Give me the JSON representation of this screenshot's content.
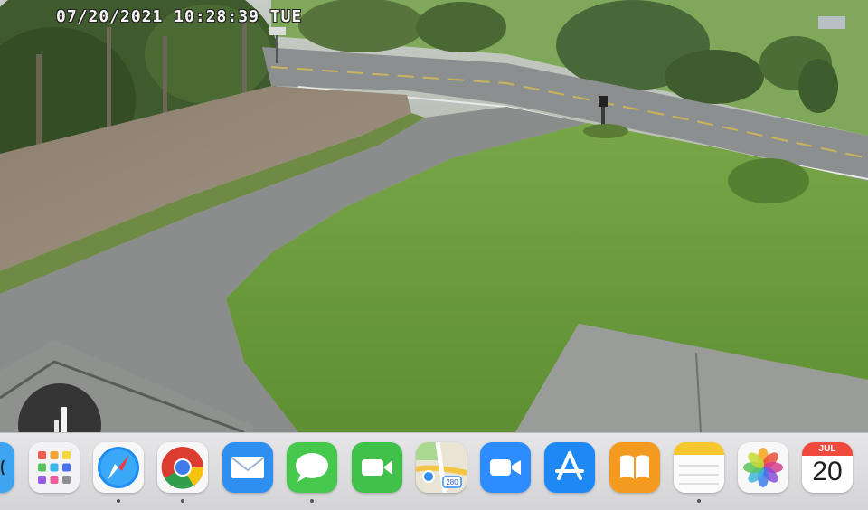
{
  "camera": {
    "timestamp": "07/20/2021 10:28:39 TUE"
  },
  "dock": {
    "apps": [
      {
        "name": "Finder",
        "icon": "finder-icon",
        "running": false
      },
      {
        "name": "Launchpad",
        "icon": "launchpad-icon",
        "running": false
      },
      {
        "name": "Safari",
        "icon": "safari-icon",
        "running": true
      },
      {
        "name": "Google Chrome",
        "icon": "chrome-icon",
        "running": true
      },
      {
        "name": "Mail",
        "icon": "mail-icon",
        "running": false
      },
      {
        "name": "Messages",
        "icon": "messages-icon",
        "running": true
      },
      {
        "name": "FaceTime",
        "icon": "facetime-icon",
        "running": false
      },
      {
        "name": "Maps",
        "icon": "maps-icon",
        "running": false
      },
      {
        "name": "Zoom",
        "icon": "zoom-icon",
        "running": false
      },
      {
        "name": "App Store",
        "icon": "app-store-icon",
        "running": false
      },
      {
        "name": "Books",
        "icon": "books-icon",
        "running": false
      },
      {
        "name": "Notes",
        "icon": "notes-icon",
        "running": true
      },
      {
        "name": "Photos",
        "icon": "photos-icon",
        "running": false
      },
      {
        "name": "Calendar",
        "icon": "calendar-icon",
        "running": false
      }
    ],
    "calendar": {
      "month": "JUL",
      "day": "20"
    },
    "maps_badge": "280"
  },
  "colors": {
    "grass": "#6a9a3c",
    "pavement": "#8b8e8d",
    "dock_bg": "#dcdcdf"
  }
}
